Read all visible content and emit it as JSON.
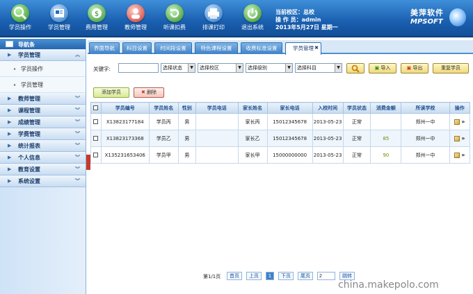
{
  "toolbar": {
    "items": [
      {
        "label": "学员操作",
        "icon": "magnifier-icon",
        "color": "#2b8c1f"
      },
      {
        "label": "学员管理",
        "icon": "student-card-icon",
        "color": "#1c6fc0"
      },
      {
        "label": "费用管理",
        "icon": "money-icon",
        "color": "#2a8d2e"
      },
      {
        "label": "教师管理",
        "icon": "teacher-icon",
        "color": "#c9322a"
      },
      {
        "label": "听课扣费",
        "icon": "refresh-icon",
        "color": "#2b8c1f"
      },
      {
        "label": "排课打印",
        "icon": "print-icon",
        "color": "#1c6fc0"
      },
      {
        "label": "退出系统",
        "icon": "power-icon",
        "color": "#2b8c1f"
      }
    ]
  },
  "user_info": {
    "campus_label": "当前校区：",
    "campus": "总校",
    "operator_label": "操 作 员：",
    "operator": "admin",
    "date": "2013年5月27日 星期一"
  },
  "brand": {
    "cn": "美萍软件",
    "en": "MPSOFT"
  },
  "sidebar": {
    "title": "导航条",
    "groups": [
      {
        "label": "学员管理",
        "expanded": true,
        "items": [
          "学员操作",
          "学员管理"
        ]
      },
      {
        "label": "教师管理"
      },
      {
        "label": "课程管理"
      },
      {
        "label": "成绩管理"
      },
      {
        "label": "学费管理"
      },
      {
        "label": "统计报表"
      },
      {
        "label": "个人信息"
      },
      {
        "label": "教育设置"
      },
      {
        "label": "系统设置"
      }
    ]
  },
  "tabs": [
    "界面导航",
    "科目设置",
    "时间段设置",
    "特色课程设置",
    "收费标准设置",
    "学员管理"
  ],
  "active_tab": "学员管理",
  "search": {
    "keyword_label": "关键字:",
    "keyword_value": "",
    "status_select": "选择状态",
    "campus_select": "选择校区",
    "level_select": "选择级别",
    "subject_select": "选择科目",
    "search_button": "",
    "import_button": "导入",
    "export_button": "导出",
    "reset_button": "重复学员"
  },
  "actions": {
    "add_button": "添加学员",
    "delete_button": "删除"
  },
  "table": {
    "columns": [
      "学员编号",
      "学员姓名",
      "性别",
      "学员电话",
      "家长姓名",
      "家长电话",
      "入校时间",
      "学员状态",
      "消费金额",
      "所读学校",
      "操作"
    ],
    "rows": [
      {
        "id": "X13823177184",
        "name": "学员丙",
        "gender": "男",
        "phone": "",
        "parent": "家长丙",
        "parent_phone": "15012345678",
        "date": "2013-05-23",
        "status": "正常",
        "amount": "",
        "school": "郑州一中"
      },
      {
        "id": "X13823173368",
        "name": "学员乙",
        "gender": "男",
        "phone": "",
        "parent": "家长乙",
        "parent_phone": "15012345678",
        "date": "2013-05-23",
        "status": "正常",
        "amount": "85",
        "school": "郑州一中"
      },
      {
        "id": "X135231653406",
        "name": "学员甲",
        "gender": "男",
        "phone": "",
        "parent": "家长甲",
        "parent_phone": "15000000000",
        "date": "2013-05-23",
        "status": "正常",
        "amount": "90",
        "school": "郑州一中"
      }
    ]
  },
  "pager": {
    "summary": "第1/1页",
    "first": "首页",
    "prev": "上页",
    "current": "1",
    "next": "下页",
    "last": "尾页",
    "goto_value": "2",
    "goto_button": "跳转"
  },
  "watermark": "china.makepolo.com"
}
